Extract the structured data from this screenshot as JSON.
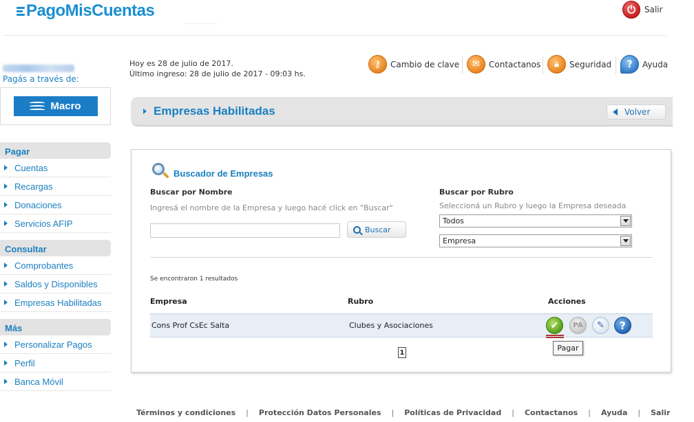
{
  "header": {
    "logo": "PagoMisCuentas",
    "salir_label": "Salir"
  },
  "sidebar": {
    "pagas_label": "Pagás a través de:",
    "bank_name": "Macro",
    "sections": [
      {
        "title": "Pagar",
        "items": [
          "Cuentas",
          "Recargas",
          "Donaciones",
          "Servicios AFIP"
        ]
      },
      {
        "title": "Consultar",
        "items": [
          "Comprobantes",
          "Saldos y Disponibles",
          "Empresas Habilitadas"
        ]
      },
      {
        "title": "Más",
        "items": [
          "Personalizar Pagos",
          "Perfil",
          "Banca Móvil"
        ]
      }
    ]
  },
  "info": {
    "today": "Hoy es 28 de julio de 2017.",
    "last_login": "Último ingreso: 28 de julio de 2017 - 09:03 hs."
  },
  "toolbar": {
    "cambio_clave": "Cambio de clave",
    "contactanos": "Contactanos",
    "seguridad": "Seguridad",
    "ayuda": "Ayuda"
  },
  "page": {
    "title": "Empresas Habilitadas",
    "volver_label": "Volver"
  },
  "search": {
    "title": "Buscador de Empresas",
    "by_name_label": "Buscar por Nombre",
    "by_name_hint": "Ingresá el nombre de la Empresa y luego hacé click en \"Buscar\"",
    "name_value": "",
    "buscar_label": "Buscar",
    "by_rubro_label": "Buscar por Rubro",
    "by_rubro_hint": "Seleccioná un Rubro y luego la Empresa deseada",
    "rubro_selected": "Todos",
    "empresa_selected": "Empresa"
  },
  "results": {
    "summary": "Se encontraron 1 resultados",
    "columns": {
      "empresa": "Empresa",
      "rubro": "Rubro",
      "acciones": "Acciones"
    },
    "rows": [
      {
        "empresa": "Cons Prof CsEc Salta",
        "rubro": "Clubes y Asociaciones"
      }
    ],
    "pa_label": "PA",
    "tooltip": "Pagar",
    "page": "1"
  },
  "footer": {
    "links": [
      "Términos y condiciones",
      "Protección Datos Personales",
      "Políticas de Privacidad",
      "Contactanos",
      "Ayuda",
      "Salir"
    ]
  },
  "colors": {
    "brand_blue": "#1a7fc0",
    "panel_gray": "#e4e4e4",
    "row_blue": "#e7eef6"
  }
}
